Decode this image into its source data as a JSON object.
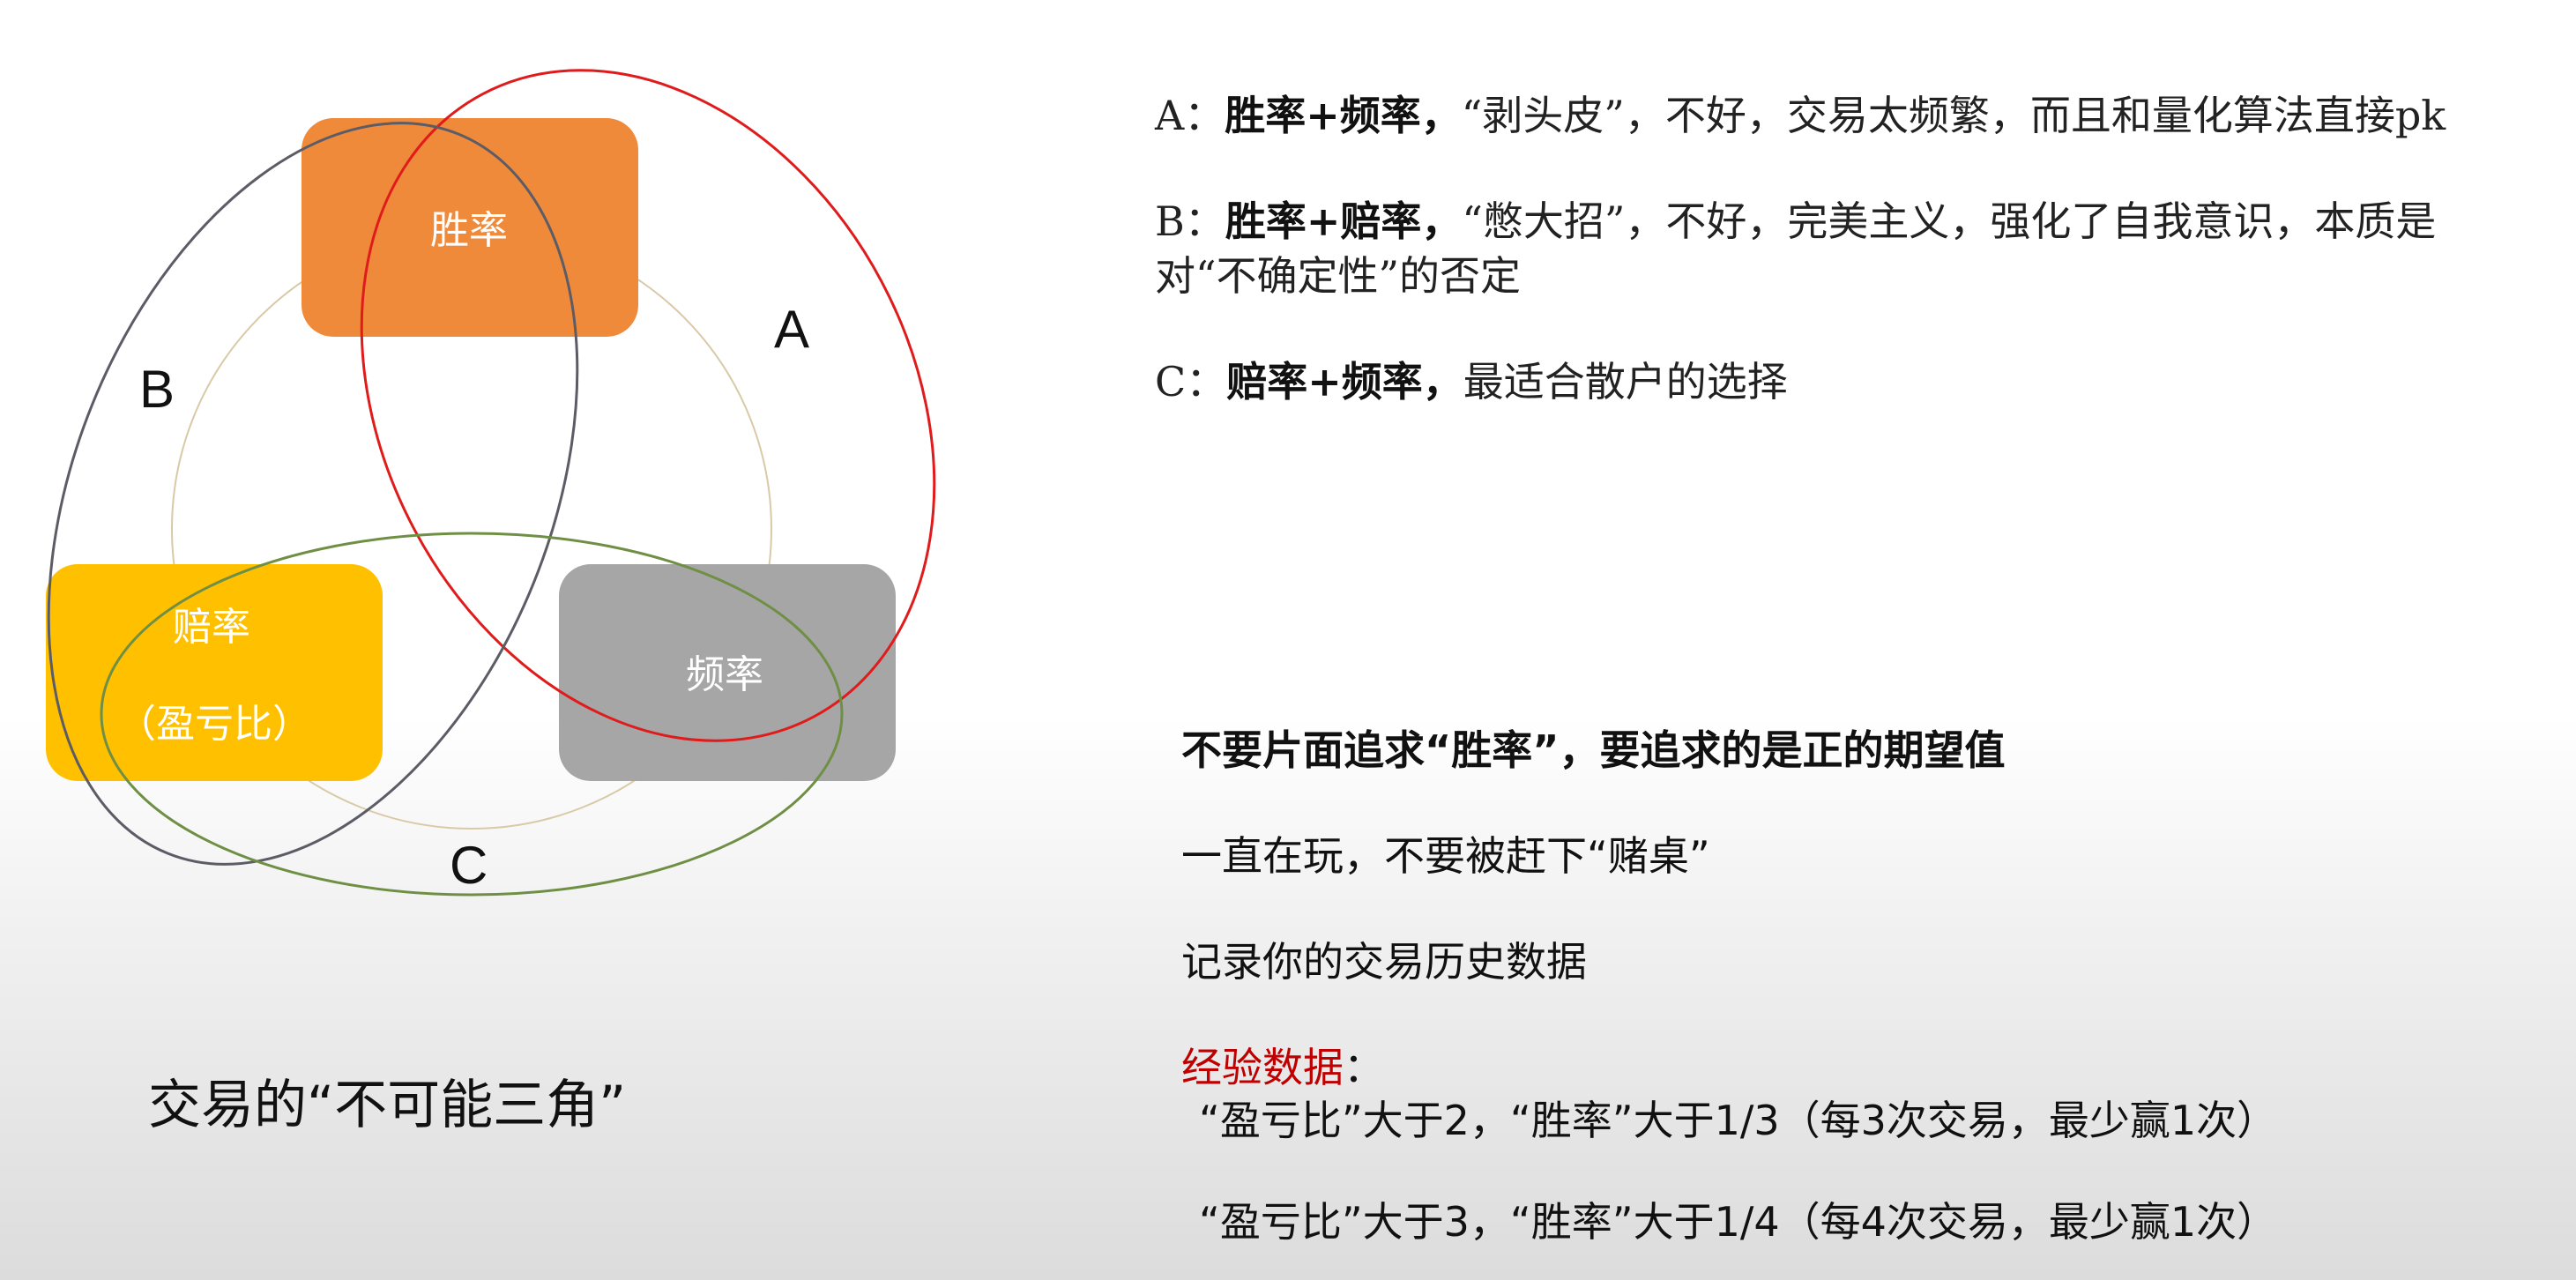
{
  "diagram": {
    "boxes": {
      "win_rate": "胜率",
      "odds_line1": "赔率",
      "odds_line2": "（盈亏比）",
      "frequency": "频率"
    },
    "letters": {
      "a": "A",
      "b": "B",
      "c": "C"
    },
    "colors": {
      "win_rate_box": "#f08a3b",
      "odds_box": "#ffc000",
      "frequency_box": "#a6a6a6",
      "ellipse_a": "#e01b1b",
      "ellipse_b": "#5c5c66",
      "ellipse_c": "#6f8f45"
    }
  },
  "caption": "交易的“不可能三角”",
  "notes": [
    {
      "prefix": "A：",
      "bold": "胜率+频率，",
      "text": "“剥头皮”，不好，交易太频繁，而且和量化算法直接pk"
    },
    {
      "prefix": "B：",
      "bold": "胜率+赔率，",
      "text": "“憋大招”，不好，完美主义，强化了自我意识，本质是对“不确定性”的否定"
    },
    {
      "prefix": "C：",
      "bold": "赔率+频率，",
      "text": "最适合散户的选择"
    }
  ],
  "tips": {
    "main": "不要片面追求“胜率”，要追求的是正的期望值",
    "keep_playing": "一直在玩，不要被赶下“赌桌”",
    "record": "记录你的交易历史数据",
    "experience_label": "经验数据",
    "experience_colon": "：",
    "rule1": "“盈亏比”大于2，“胜率”大于1/3（每3次交易，最少赢1次）",
    "rule2": "“盈亏比”大于3，“胜率”大于1/4（每4次交易，最少赢1次）"
  }
}
